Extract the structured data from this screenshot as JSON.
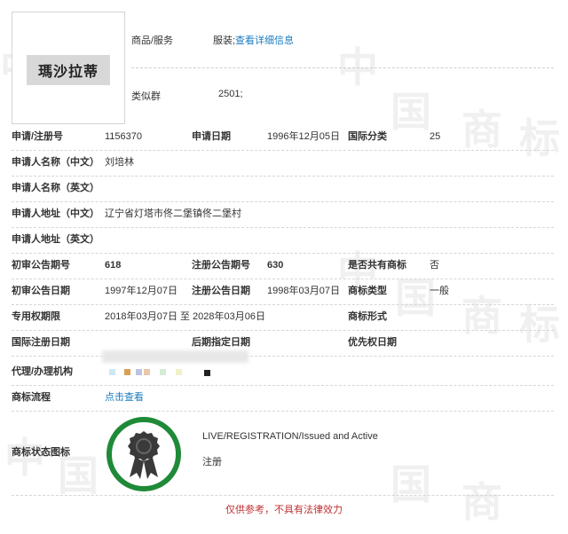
{
  "logo": {
    "text": "瑪沙拉蒂"
  },
  "header": {
    "goods_label": "商品/服务",
    "goods_value": "服装;",
    "goods_link": "查看详细信息",
    "class_label": "类似群",
    "class_value": "2501;"
  },
  "rows": {
    "app_no_label": "申请/注册号",
    "app_no_value": "1156370",
    "app_date_label": "申请日期",
    "app_date_value": "1996年12月05日",
    "intl_class_label": "国际分类",
    "intl_class_value": "25",
    "applicant_cn_label": "申请人名称（中文）",
    "applicant_cn_value": "刘培林",
    "applicant_en_label": "申请人名称（英文）",
    "address_cn_label": "申请人地址（中文）",
    "address_cn_value": "辽宁省灯塔市佟二堡镇佟二堡村",
    "address_en_label": "申请人地址（英文）",
    "prelim_no_label": "初审公告期号",
    "prelim_no_value": "618",
    "reg_no_label": "注册公告期号",
    "reg_no_value": "630",
    "shared_label": "是否共有商标",
    "shared_value": "否",
    "prelim_date_label": "初审公告日期",
    "prelim_date_value": "1997年12月07日",
    "reg_date_label": "注册公告日期",
    "reg_date_value": "1998年03月07日",
    "type_label": "商标类型",
    "type_value": "一般",
    "period_label": "专用权期限",
    "period_value": "2018年03月07日 至 2028年03月06日",
    "form_label": "商标形式",
    "intl_reg_label": "国际注册日期",
    "later_label": "后期指定日期",
    "priority_label": "优先权日期",
    "agent_label": "代理/办理机构",
    "flow_label": "商标流程",
    "flow_link": "点击查看",
    "status_label": "商标状态图标",
    "status_en": "LIVE/REGISTRATION/Issued and Active",
    "status_cn": "注册"
  },
  "footer": {
    "note": "仅供参考，不具有法律效力"
  },
  "colors": {
    "link": "#1a7bbf",
    "seal_green": "#1f8a38",
    "note_red": "#c03030"
  },
  "icons": {
    "status": "award-ribbon-icon"
  }
}
